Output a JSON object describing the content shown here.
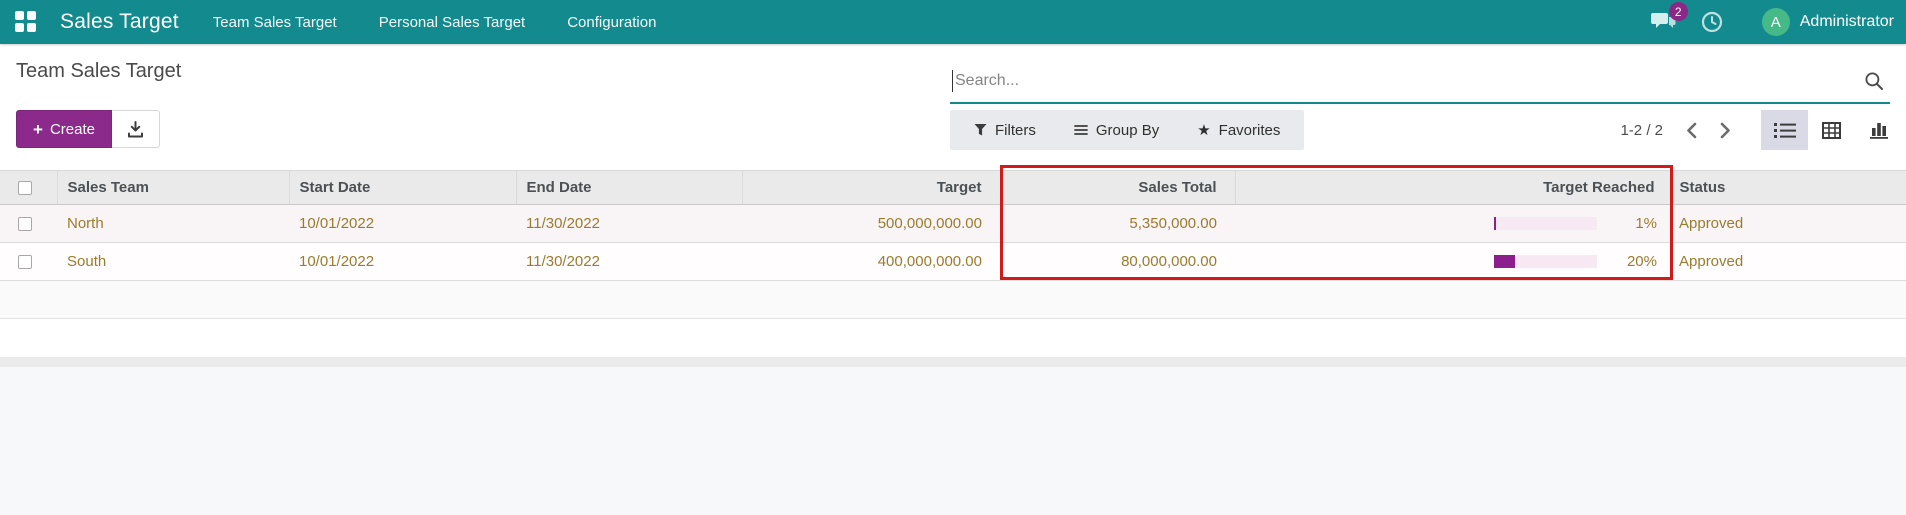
{
  "navbar": {
    "brand": "Sales Target",
    "menu": [
      "Team Sales Target",
      "Personal Sales Target",
      "Configuration"
    ],
    "messages_badge": "2",
    "user_initial": "A",
    "user_name": "Administrator"
  },
  "control_panel": {
    "breadcrumb": "Team Sales Target",
    "create_label": "Create",
    "create_icon_char": "+",
    "search_placeholder": "Search...",
    "filters_label": "Filters",
    "group_by_label": "Group By",
    "favorites_label": "Favorites",
    "favorites_star_char": "★",
    "pager_range": "1-2 / 2"
  },
  "table": {
    "columns": [
      "",
      "Sales Team",
      "Start Date",
      "End Date",
      "Target",
      "Sales Total",
      "Target Reached",
      "Status"
    ],
    "rows": [
      {
        "team": "North",
        "start_date": "10/01/2022",
        "end_date": "11/30/2022",
        "target": "500,000,000.00",
        "sales_total": "5,350,000.00",
        "target_reached_pct": 1,
        "target_reached_label": "1%",
        "status": "Approved"
      },
      {
        "team": "South",
        "start_date": "10/01/2022",
        "end_date": "11/30/2022",
        "target": "400,000,000.00",
        "sales_total": "80,000,000.00",
        "target_reached_pct": 20,
        "target_reached_label": "20%",
        "status": "Approved"
      }
    ]
  },
  "annotation": {
    "type": "red-highlight-box",
    "highlighted_columns": "Sales Total, Target Reached",
    "color": "#d11b1b"
  },
  "colors": {
    "navbar_teal": "#128a8e",
    "primary_purple": "#8c2a8c",
    "row_text_gold": "#9a7c2e",
    "progress_fill": "#8b1f8b",
    "progress_bg": "#f8e8f3",
    "badge_purple": "#8c2785",
    "avatar_green": "#46b988",
    "header_bg": "#eaeaea"
  },
  "icons": {
    "apps": "grid-2x2",
    "messages": "speech-bubbles",
    "activities": "clock",
    "export": "download-tray",
    "search": "magnifier",
    "filters": "funnel",
    "group_by": "horizontal-bars",
    "favorites": "star",
    "pager_prev": "chevron-left",
    "pager_next": "chevron-right",
    "view_list": "list-bullets",
    "view_pivot": "table-grid",
    "view_graph": "bar-chart"
  }
}
